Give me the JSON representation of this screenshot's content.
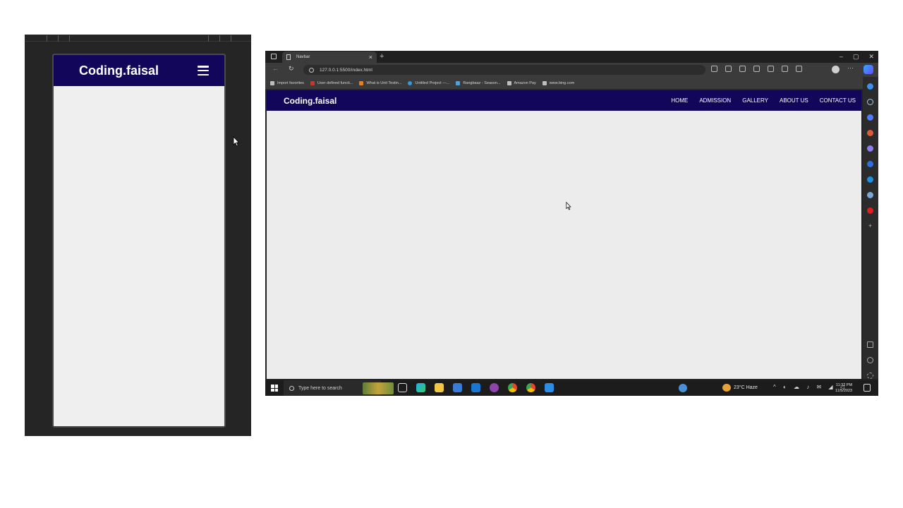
{
  "mobile": {
    "brand": "Coding.faisal"
  },
  "browser": {
    "tab_title": "Navbar",
    "tab_close": "×",
    "new_tab": "+",
    "window_controls": [
      "–",
      "▢",
      "✕"
    ],
    "nav_back": "←",
    "nav_reload": "↻",
    "url": "127.0.0.1:5500/index.html",
    "more_menu": "···",
    "favorites": [
      "Import favorites",
      "User defined functi...",
      "What is Unit Testin...",
      "Untitled Project —...",
      "Rangbaaz - Season...",
      "Amazon Pay",
      "www.bing.com"
    ]
  },
  "site": {
    "brand": "Coding.faisal",
    "nav_links": [
      "HOME",
      "ADMISSION",
      "GALLERY",
      "ABOUT US",
      "CONTACT US"
    ]
  },
  "taskbar": {
    "search_placeholder": "Type here to search",
    "weather": "23°C  Haze",
    "tray_icons": "^ ◐ ☁ ♪ ✉ ◢ ◁",
    "time": "11:32 PM",
    "date": "11/5/2023"
  },
  "colors": {
    "navbar_bg": "#12065a",
    "page_bg": "#ececec",
    "mobile_frame_bg": "#252525"
  },
  "icons": [
    "hamburger-menu-icon",
    "mouse-cursor-icon",
    "start-windows-icon",
    "search-icon",
    "edge-browser-icon",
    "chrome-browser-icon",
    "vscode-icon",
    "weather-icon",
    "notification-icon"
  ]
}
